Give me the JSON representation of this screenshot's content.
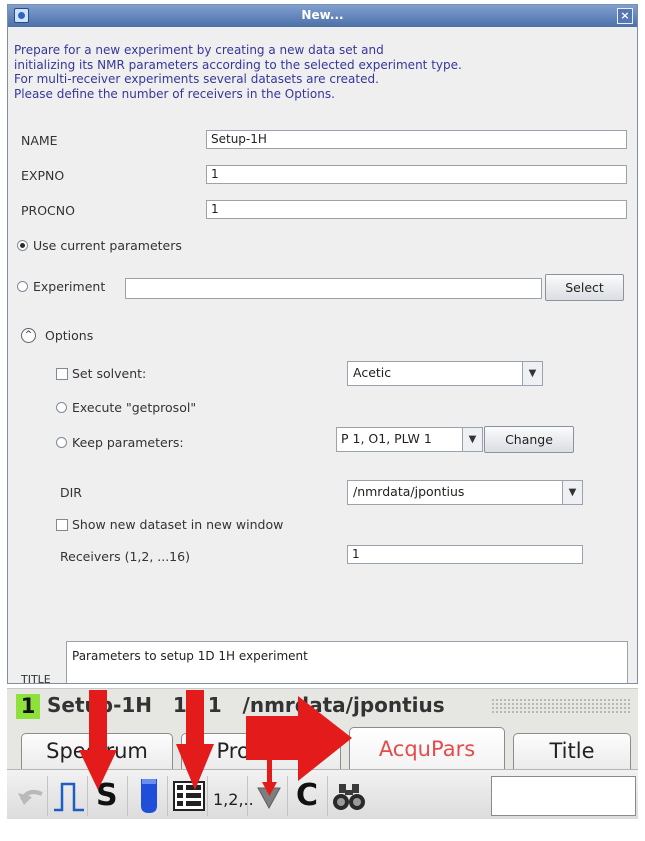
{
  "dialog": {
    "title": "New...",
    "close_label": "×",
    "description": [
      "Prepare for a new experiment by creating a new data set and",
      "initializing its NMR parameters according to the selected experiment type.",
      "For multi-receiver experiments several datasets are created.",
      "Please define the number of receivers in the Options."
    ],
    "fields": {
      "name": {
        "label": "NAME",
        "value": "Setup-1H"
      },
      "expno": {
        "label": "EXPNO",
        "value": "1"
      },
      "procno": {
        "label": "PROCNO",
        "value": "1"
      }
    },
    "use_current_label": "Use current parameters",
    "experiment_label": "Experiment",
    "experiment_value": "",
    "select_button": "Select",
    "options_label": "Options",
    "options_toggle_glyph": "^",
    "options": {
      "set_solvent_label": "Set solvent:",
      "solvent_value": "Acetic",
      "execute_label": "Execute \"getprosol\"",
      "keep_label": "Keep parameters:",
      "keep_value": "P 1, O1, PLW 1",
      "change_button": "Change",
      "dir_label": "DIR",
      "dir_value": "/nmrdata/jpontius",
      "show_new_label": "Show new dataset in new window",
      "receivers_label": "Receivers (1,2, ...16)",
      "receivers_value": "1"
    },
    "title_label": "TITLE",
    "title_value": "Parameters to setup 1D 1H experiment",
    "combo_arrow_glyph": "▼"
  },
  "topspin": {
    "dataset_number": "1",
    "dataset_text": "Setup-1H   1   1   /nmrdata/jpontius",
    "tabs": [
      "Spectrum",
      "ProcPars",
      "AcquPars",
      "Title"
    ],
    "active_tab_index": 2,
    "toolbar": {
      "s_label": "S",
      "c_label": "C",
      "numbers_label": "1,2,.."
    }
  },
  "colors": {
    "description_text": "#36379a",
    "active_tab_text": "#e34c4c",
    "annotation_arrow": "#e31b1b",
    "dataset_number_bg": "#8ee03a"
  }
}
